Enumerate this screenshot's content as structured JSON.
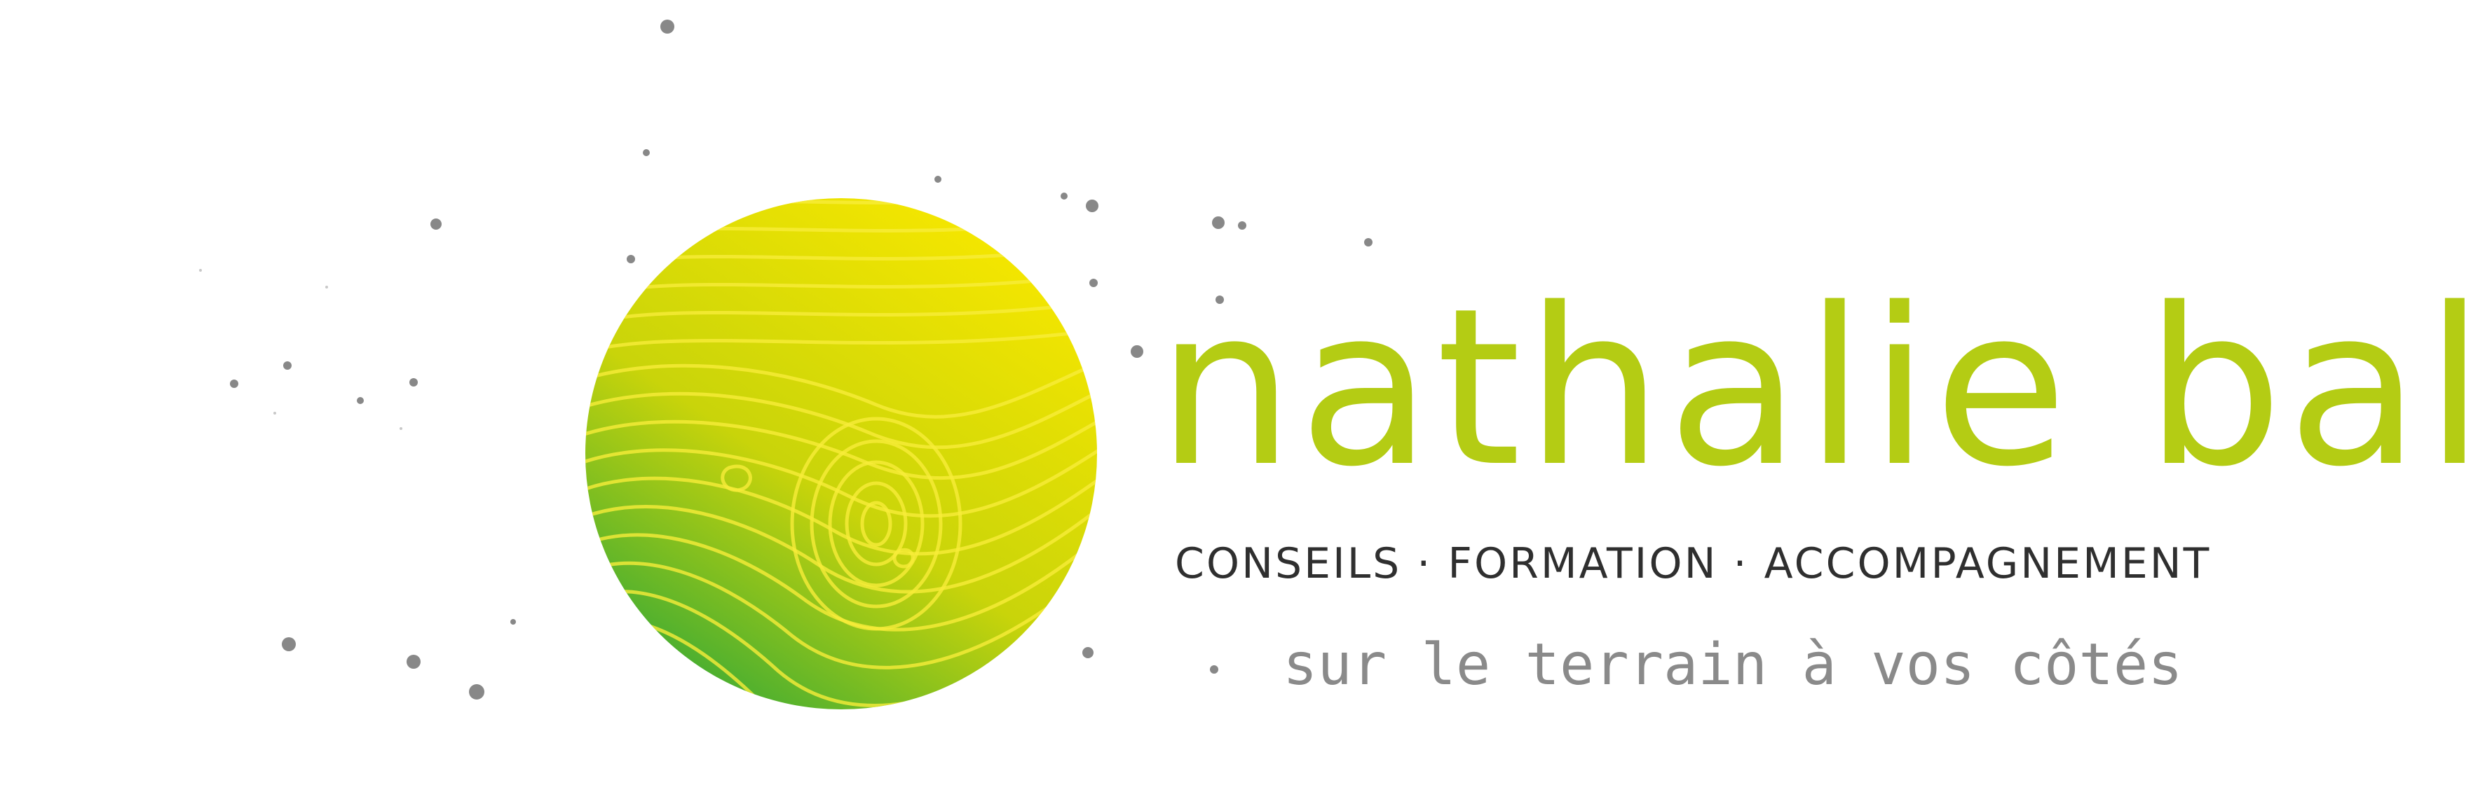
{
  "logo": {
    "name": "nathalie ball",
    "services": "CONSEILS · FORMATION · ACCOMPAGNEMENT",
    "tagline": "sur le terrain à vos côtés",
    "icon": "fingerprint-globe-icon"
  },
  "colors": {
    "brand_green": "#b4cc14",
    "gradient_yellow": "#f4e600",
    "gradient_green": "#3aaa35",
    "services_text": "#2f2f2f",
    "tagline_text": "#8a8a8a",
    "dot_grey": "#888888"
  }
}
